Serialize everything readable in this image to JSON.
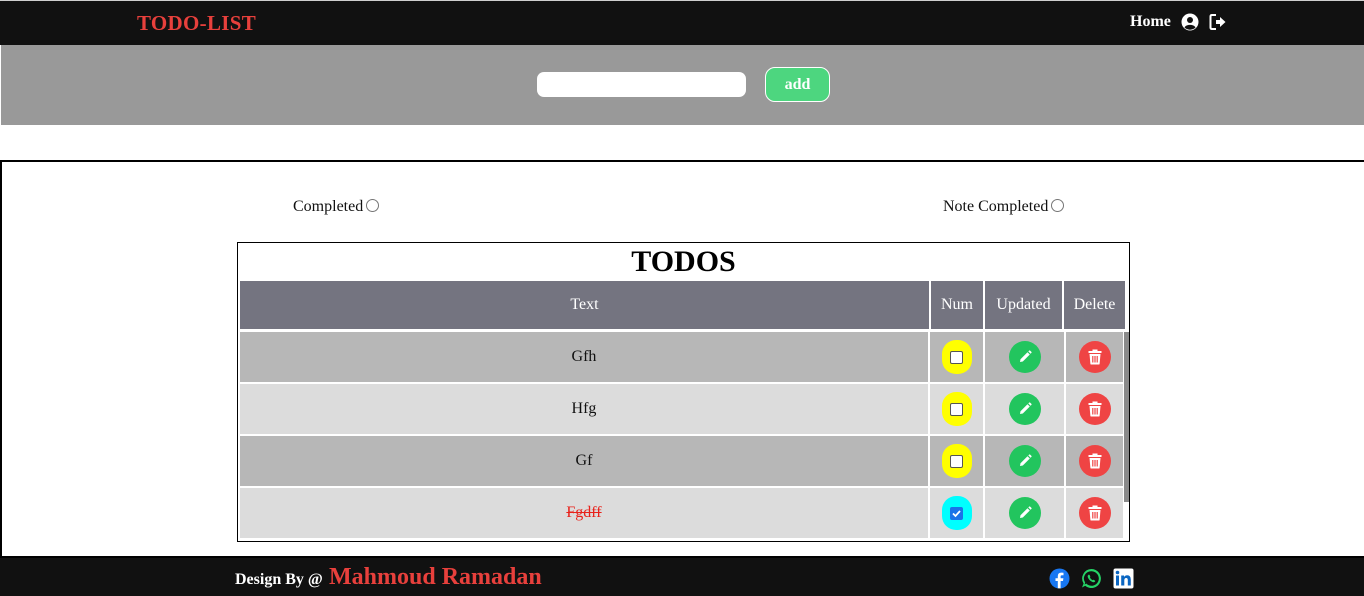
{
  "navbar": {
    "brand": "TODO-LIST",
    "home_label": "Home",
    "user_icon": "user-circle-icon",
    "logout_icon": "sign-out-icon"
  },
  "input_bar": {
    "input_value": "",
    "add_label": "add"
  },
  "filters": {
    "completed_label": "Completed",
    "not_completed_label": "Note Completed"
  },
  "table": {
    "title": "TODOS",
    "headers": {
      "text": "Text",
      "num": "Num",
      "updated": "Updated",
      "delete": "Delete"
    },
    "rows": [
      {
        "text": "Gfh",
        "completed": false
      },
      {
        "text": "Hfg",
        "completed": false
      },
      {
        "text": "Gf",
        "completed": false
      },
      {
        "text": "Fgdff",
        "completed": true
      }
    ]
  },
  "footer": {
    "design_by": "Design By @",
    "author": "Mahmoud Ramadan",
    "social": [
      "facebook-icon",
      "whatsapp-icon",
      "linkedin-icon"
    ]
  },
  "colors": {
    "brand_red": "#e8403c",
    "add_green": "#4dd67f",
    "pill_yellow": "#ffff00",
    "pill_cyan": "#00ffff",
    "edit_green": "#22c55e",
    "delete_red": "#ef4444"
  }
}
